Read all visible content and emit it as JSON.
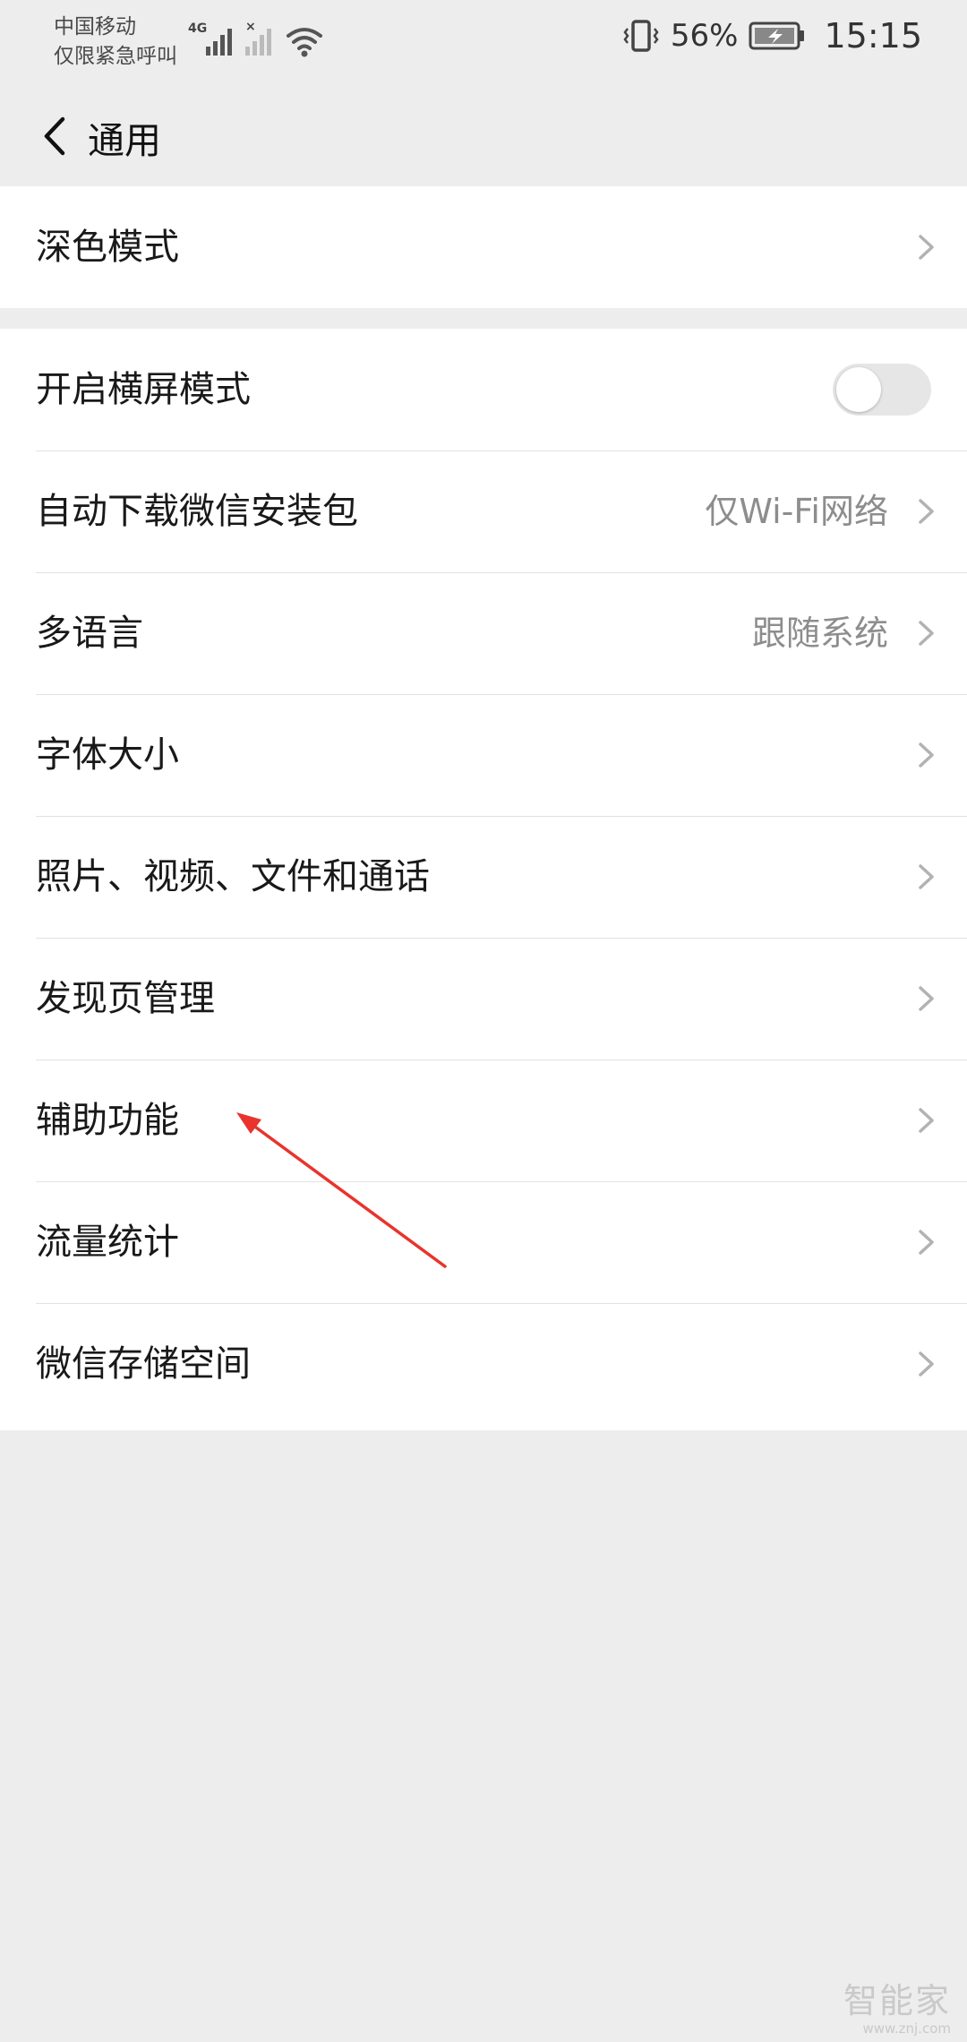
{
  "status_bar": {
    "carrier_line1": "中国移动",
    "carrier_line2": "仅限紧急呼叫",
    "network_type": "4G",
    "battery_percent": "56%",
    "time": "15:15"
  },
  "nav": {
    "title": "通用",
    "back_icon": "chevron-left-icon"
  },
  "groups": [
    [
      {
        "label": "深色模式",
        "value": "",
        "control": "chevron"
      }
    ],
    [
      {
        "label": "开启横屏模式",
        "value": "",
        "control": "toggle",
        "toggle_on": false
      },
      {
        "label": "自动下载微信安装包",
        "value": "仅Wi-Fi网络",
        "control": "chevron"
      },
      {
        "label": "多语言",
        "value": "跟随系统",
        "control": "chevron"
      },
      {
        "label": "字体大小",
        "value": "",
        "control": "chevron"
      },
      {
        "label": "照片、视频、文件和通话",
        "value": "",
        "control": "chevron"
      },
      {
        "label": "发现页管理",
        "value": "",
        "control": "chevron"
      },
      {
        "label": "辅助功能",
        "value": "",
        "control": "chevron"
      },
      {
        "label": "流量统计",
        "value": "",
        "control": "chevron"
      },
      {
        "label": "微信存储空间",
        "value": "",
        "control": "chevron"
      }
    ]
  ],
  "annotation": {
    "color": "#e8342c",
    "points_to": "辅助功能"
  },
  "watermark": {
    "logo": "智能家",
    "url": "www.znj.com"
  },
  "colors": {
    "background": "#ededed",
    "row_background": "#ffffff",
    "secondary_text": "#8d8d8d",
    "toggle_off": "#e6e6e6"
  }
}
